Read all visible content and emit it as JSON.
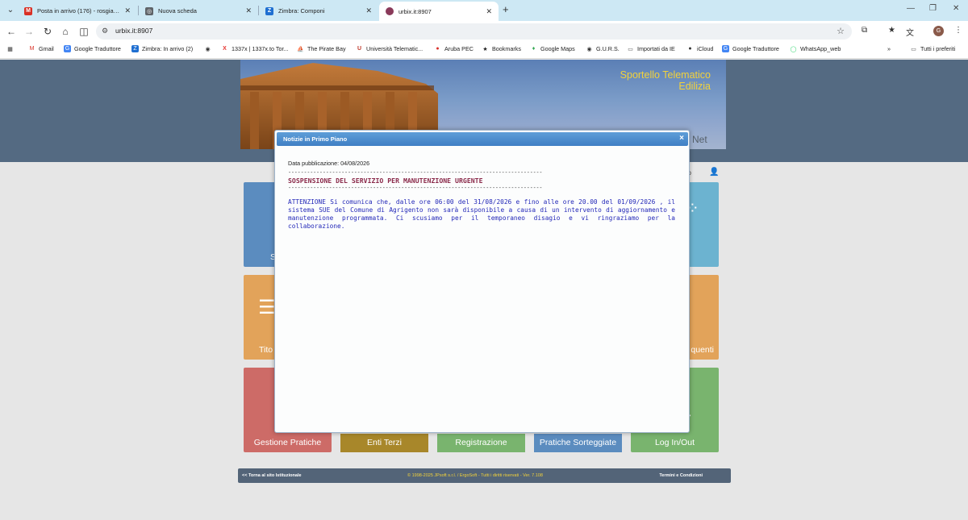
{
  "browser": {
    "tabs": [
      {
        "title": "Posta in arrivo (176) - rosgia3@",
        "favicon_color": "#d93025",
        "favicon_glyph": "M",
        "active": false
      },
      {
        "title": "Nuova scheda",
        "favicon_color": "#5f6368",
        "favicon_glyph": "◎",
        "active": false
      },
      {
        "title": "Zimbra: Componi",
        "favicon_color": "#1f6fd1",
        "favicon_glyph": "Z",
        "active": false
      },
      {
        "title": "urbix.it:8907",
        "favicon_color": "#8a3a5a",
        "favicon_glyph": "●",
        "active": true
      }
    ],
    "address": "urbix.it:8907",
    "bookmarks": [
      {
        "label": "Gmail",
        "icon": "gmail-icon",
        "color": "#d93025",
        "glyph": "M"
      },
      {
        "label": "Google Traduttore",
        "icon": "translate-icon",
        "color": "#4285f4",
        "glyph": "G"
      },
      {
        "label": "Zimbra: In arrivo (2)",
        "icon": "zimbra-icon",
        "color": "#1f6fd1",
        "glyph": "Z"
      },
      {
        "label": "",
        "icon": "globe-icon",
        "color": "#333333",
        "glyph": "◉"
      },
      {
        "label": "1337x | 1337x.to Tor...",
        "icon": "x-icon",
        "color": "#e5322d",
        "glyph": "X"
      },
      {
        "label": "The Pirate Bay",
        "icon": "ship-icon",
        "color": "#333333",
        "glyph": "⛵"
      },
      {
        "label": "Università Telematic...",
        "icon": "university-icon",
        "color": "#c0392b",
        "glyph": "U"
      },
      {
        "label": "Aruba PEC",
        "icon": "aruba-icon",
        "color": "#d9302a",
        "glyph": "●"
      },
      {
        "label": "Bookmarks",
        "icon": "star-icon",
        "color": "#222222",
        "glyph": "★"
      },
      {
        "label": "Google Maps",
        "icon": "maps-icon",
        "color": "#34a853",
        "glyph": "♦"
      },
      {
        "label": "G.U.R.S.",
        "icon": "globe-icon",
        "color": "#333333",
        "glyph": "◉"
      },
      {
        "label": "Importati da IE",
        "icon": "folder-icon",
        "color": "#555555",
        "glyph": "▭"
      },
      {
        "label": "iCloud",
        "icon": "apple-icon",
        "color": "#333333",
        "glyph": "●"
      },
      {
        "label": "Google Traduttore",
        "icon": "translate-icon",
        "color": "#4285f4",
        "glyph": "G"
      },
      {
        "label": "WhatsApp_web",
        "icon": "whatsapp-icon",
        "color": "#25d366",
        "glyph": "◯"
      }
    ],
    "all_bookmarks_label": "Tutti i preferiti"
  },
  "portal": {
    "title_line1": "Sportello Telematico",
    "title_line2": "Edilizia",
    "net_label": "Net",
    "user_status": "icato",
    "tiles_top": [
      {
        "label": "S",
        "color": "#5b8cbf"
      },
      {
        "label": "",
        "color": "#6cb3d0"
      }
    ],
    "tiles_mid": [
      {
        "label": "Tito",
        "color": "#e2a35a"
      },
      {
        "label": "quenti",
        "color": "#e2a35a"
      }
    ],
    "tiles_bottom": [
      {
        "label": "Gestione Pratiche",
        "color": "#cd6b67"
      },
      {
        "label": "Enti Terzi",
        "color": "#a8872a"
      },
      {
        "label": "Registrazione",
        "color": "#79b46e"
      },
      {
        "label": "Pratiche Sorteggiate",
        "color": "#5b8cbf"
      },
      {
        "label": "Log In/Out",
        "color": "#79b46e"
      }
    ],
    "footer": {
      "back_link": "<< Torna al sito Istituzionale",
      "copyright": "© 1998-2025 JPsoft s.r.l. / ErgoSoft - Tutti i diritti riservati - Ver. 7.108",
      "terms_link": "Termini e Condizioni"
    }
  },
  "modal": {
    "title": "Notizie in Primo Piano",
    "close_glyph": "×",
    "pub_date": "Data pubblicazione: 04/08/2026",
    "dashes": "--------------------------------------------------------------------------------------------",
    "news_title": "SOSPENSIONE DEL SERVIZIO PER MANUTENZIONE URGENTE",
    "news_text": "ATTENZIONE Si comunica che, dalle ore 06:00 del 31/08/2026 e fino alle ore 20.00 del 01/09/2026 , il sistema SUE del Comune di Agrigento non sarà disponibile a causa di un intervento di aggiornamento e manutenzione programmata. Ci scusiamo per il temporaneo disagio e vi ringraziamo per la collaborazione."
  }
}
